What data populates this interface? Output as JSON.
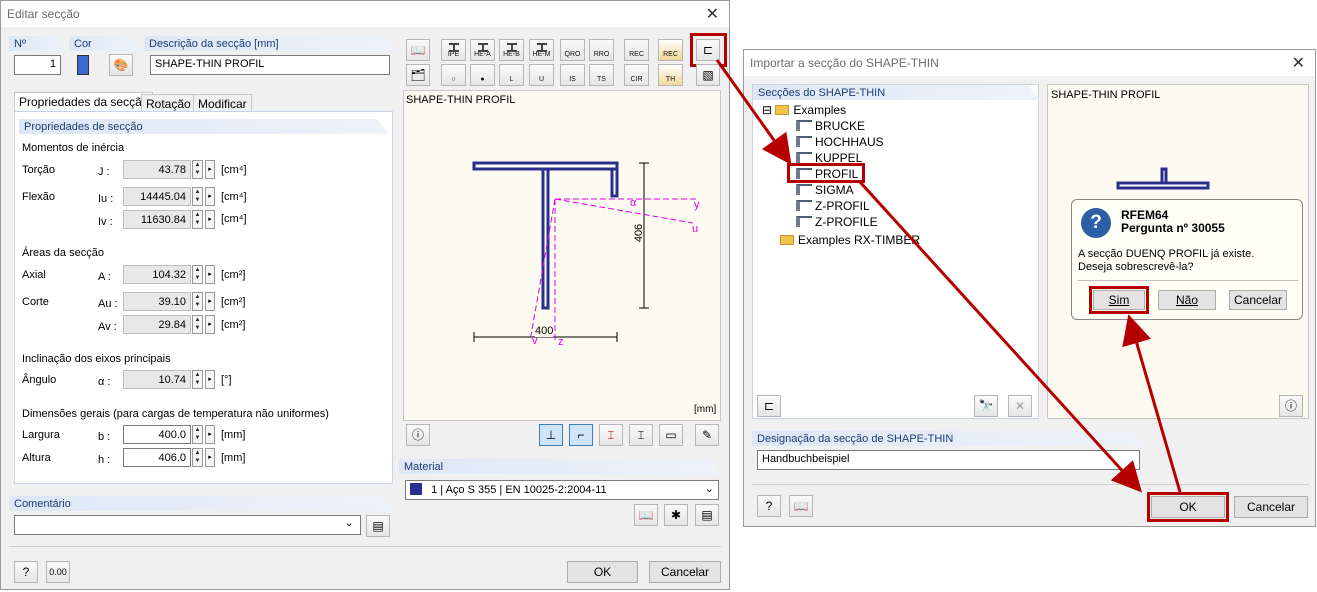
{
  "dialog1": {
    "title": "Editar secção",
    "no_label": "Nº",
    "no_value": "1",
    "cor_label": "Cor",
    "desc_label": "Descrição da secção [mm]",
    "desc_value": "SHAPE-THIN PROFIL",
    "tabs": [
      "Propriedades da secção",
      "Rotação",
      "Modificar"
    ],
    "props_header": "Propriedades de secção",
    "inertia_header": "Momentos de inércia",
    "rows": [
      {
        "label": "Torção",
        "sym": "J :",
        "value": "43.78",
        "unit": "[cm⁴]"
      },
      {
        "label": "Flexão",
        "sym": "Iu :",
        "value": "14445.04",
        "unit": "[cm⁴]"
      },
      {
        "label": "",
        "sym": "Iv :",
        "value": "11630.84",
        "unit": "[cm⁴]"
      },
      {
        "label": "Axial",
        "sym": "A :",
        "value": "104.32",
        "unit": "[cm²]"
      },
      {
        "label": "Corte",
        "sym": "Au :",
        "value": "39.10",
        "unit": "[cm²]"
      },
      {
        "label": "",
        "sym": "Av :",
        "value": "29.84",
        "unit": "[cm²]"
      },
      {
        "label": "Ângulo",
        "sym": "α :",
        "value": "10.74",
        "unit": "[°]"
      },
      {
        "label": "Largura",
        "sym": "b :",
        "value": "400.0",
        "unit": "[mm]"
      },
      {
        "label": "Altura",
        "sym": "h :",
        "value": "406.0",
        "unit": "[mm]"
      }
    ],
    "areas_header": "Áreas da secção",
    "incl_header": "Inclinação dos eixos principais",
    "dims_header": "Dimensões gerais (para cargas de temperatura não uniformes)",
    "comment_label": "Comentário",
    "toolbar_row1": [
      "",
      "IPE",
      "HE-A",
      "HE-B",
      "HE-M",
      "QRO",
      "RRO",
      "REC",
      ""
    ],
    "toolbar_row2": [
      "",
      "RO",
      "RD",
      "L",
      "U",
      "IS",
      "TS",
      "CIR",
      "TH",
      ""
    ],
    "preview_title": "SHAPE-THIN  PROFIL",
    "preview_unit": "[mm]",
    "dim_400": "400",
    "dim_406": "406",
    "axis_y": "y",
    "axis_u": "u",
    "axis_z": "z",
    "axis_v": "v",
    "axis_alpha": "α",
    "material_label": "Material",
    "material_no": "1",
    "material_name": "Aço S 355",
    "material_norm": "EN 10025-2:2004-11",
    "ok": "OK",
    "cancel": "Cancelar",
    "calc_icon": "0.00"
  },
  "dialog2": {
    "title": "Importar a secção do SHAPE-THIN",
    "sections_header": "Secções do SHAPE-THIN",
    "tree_root": "Examples",
    "tree_items": [
      "BRUCKE",
      "HOCHHAUS",
      "KUPPEL",
      "PROFIL",
      "SIGMA",
      "Z-PROFIL",
      "Z-PROFILE"
    ],
    "tree_root2": "Examples RX-TIMBER",
    "preview_title": "SHAPE-THIN  PROFIL",
    "designation_label": "Designação da secção de SHAPE-THIN",
    "designation_value": "Handbuchbeispiel",
    "ok": "OK",
    "cancel": "Cancelar"
  },
  "msgbox": {
    "app": "RFEM64",
    "question": "Pergunta nº 30055",
    "line1": "A secção DUENQ PROFIL já existe.",
    "line2": "Deseja sobrescrevê-la?",
    "yes": "Sim",
    "no": "Não",
    "cancel": "Cancelar"
  },
  "colors": {
    "accent_red": "#b60000",
    "header_blue": "#1a3d78",
    "profile_blue": "#2b2f8c",
    "axis_magenta": "#e000e0",
    "color_swatch": "#3a6ad0"
  }
}
